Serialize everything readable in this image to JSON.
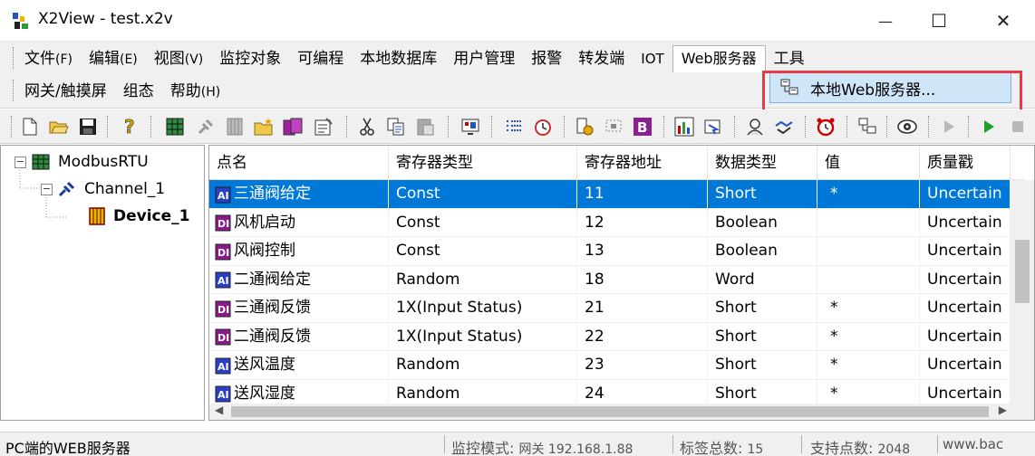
{
  "window": {
    "title": "X2View - test.x2v",
    "minimize": "—",
    "maximize": "☐",
    "close": "✕"
  },
  "menu": {
    "row1": [
      {
        "label": "文件",
        "accel": "(F)"
      },
      {
        "label": "编辑",
        "accel": "(E)"
      },
      {
        "label": "视图",
        "accel": "(V)"
      },
      {
        "label": "监控对象",
        "accel": ""
      },
      {
        "label": "可编程",
        "accel": ""
      },
      {
        "label": "本地数据库",
        "accel": ""
      },
      {
        "label": "用户管理",
        "accel": ""
      },
      {
        "label": "报警",
        "accel": ""
      },
      {
        "label": "转发端",
        "accel": ""
      },
      {
        "label": "IOT",
        "accel": ""
      },
      {
        "label": "Web服务器",
        "accel": ""
      },
      {
        "label": "工具",
        "accel": ""
      }
    ],
    "row2": [
      {
        "label": "网关/触摸屏",
        "accel": ""
      },
      {
        "label": "组态",
        "accel": ""
      },
      {
        "label": "帮助",
        "accel": "(H)"
      }
    ],
    "dropdown_item": "本地Web服务器..."
  },
  "tree": {
    "root": "ModbusRTU",
    "channel": "Channel_1",
    "device": "Device_1"
  },
  "table": {
    "columns": [
      "点名",
      "寄存器类型",
      "寄存器地址",
      "数据类型",
      "值",
      "质量戳"
    ],
    "rows": [
      {
        "name": "三通阀给定",
        "icon": "AI",
        "reg_type": "Const",
        "addr": "11",
        "dtype": "Short",
        "value": "*",
        "quality": "Uncertain"
      },
      {
        "name": "风机启动",
        "icon": "DI",
        "reg_type": "Const",
        "addr": "12",
        "dtype": "Boolean",
        "value": "",
        "quality": "Uncertain"
      },
      {
        "name": "风阀控制",
        "icon": "DI",
        "reg_type": "Const",
        "addr": "13",
        "dtype": "Boolean",
        "value": "",
        "quality": "Uncertain"
      },
      {
        "name": "二通阀给定",
        "icon": "AI",
        "reg_type": "Random",
        "addr": "18",
        "dtype": "Word",
        "value": "",
        "quality": "Uncertain"
      },
      {
        "name": "三通阀反馈",
        "icon": "DI",
        "reg_type": "1X(Input Status)",
        "addr": "21",
        "dtype": "Short",
        "value": "*",
        "quality": "Uncertain"
      },
      {
        "name": "二通阀反馈",
        "icon": "DI",
        "reg_type": "1X(Input Status)",
        "addr": "22",
        "dtype": "Short",
        "value": "*",
        "quality": "Uncertain"
      },
      {
        "name": "送风温度",
        "icon": "AI",
        "reg_type": "Random",
        "addr": "23",
        "dtype": "Short",
        "value": "*",
        "quality": "Uncertain"
      },
      {
        "name": "送风湿度",
        "icon": "AI",
        "reg_type": "Random",
        "addr": "24",
        "dtype": "Short",
        "value": "*",
        "quality": "Uncertain"
      }
    ]
  },
  "status": {
    "message": "PC端的WEB服务器",
    "mode_label": "监控模式: ",
    "mode_value": "网关 192.168.1.88",
    "tags_label": "标签总数: ",
    "tags_value": "15",
    "points_label": "支持点数: ",
    "points_value": "2048",
    "website": "www.bac"
  },
  "colors": {
    "selection": "#0078d7",
    "highlight_border": "#e53d46",
    "dropdown_bg": "#cfe5f8"
  }
}
